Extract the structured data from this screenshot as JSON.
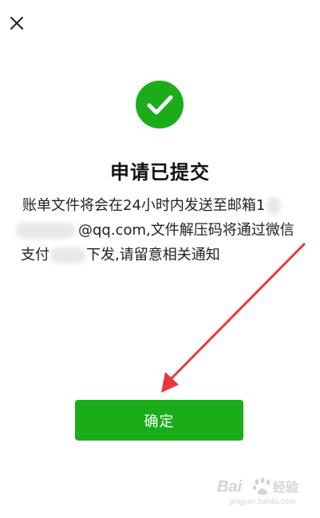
{
  "dialog": {
    "close_icon": "close-icon",
    "success_icon": "checkmark-circle-icon",
    "title": "申请已提交",
    "message": {
      "line1": "账单文件将会在24小时内发送至邮箱1",
      "line2": "@qq.com,文件解压码将通过微信",
      "line3_start": "支付",
      "line3_end": "下发,请留意相关通知"
    },
    "confirm_label": "确定"
  },
  "watermark": {
    "logo_text": "Bai",
    "logo_text_2": "经验",
    "sub_text": "jingyan.baidu.com"
  },
  "colors": {
    "accent": "#1aad19",
    "annotation_arrow": "#e8383d"
  }
}
